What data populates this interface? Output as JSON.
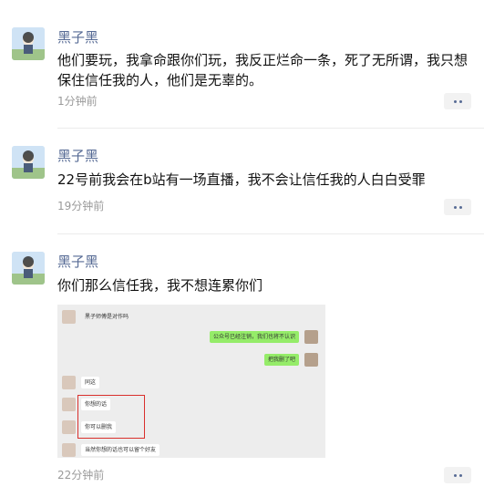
{
  "author_name": "黑子黑",
  "posts": [
    {
      "content": "他们要玩，我拿命跟你们玩，我反正烂命一条，死了无所谓，我只想保住信任我的人，他们是无辜的。",
      "time": "1分钟前"
    },
    {
      "content": "22号前我会在b站有一场直播，我不会让信任我的人白白受罪",
      "time": "19分钟前"
    },
    {
      "content": "你们那么信任我，我不想连累你们",
      "time": "22分钟前",
      "chat_image": {
        "messages": [
          {
            "side": "left",
            "text": "黑子师傅是对作吗"
          },
          {
            "side": "right",
            "text": "公众号已经注销，我们也将不认识"
          },
          {
            "side": "right",
            "text": "把我删了吧"
          },
          {
            "side": "left",
            "text": "同这"
          },
          {
            "side": "left",
            "text": "你想的话"
          },
          {
            "side": "left",
            "text": "你可以删我"
          },
          {
            "side": "left",
            "text": "当然你想的话也可以留个好友"
          }
        ]
      }
    }
  ],
  "colors": {
    "author": "#576b95",
    "time": "#9a9a9a",
    "bubble_self": "#95ec69",
    "highlight_box": "#d9302c"
  }
}
